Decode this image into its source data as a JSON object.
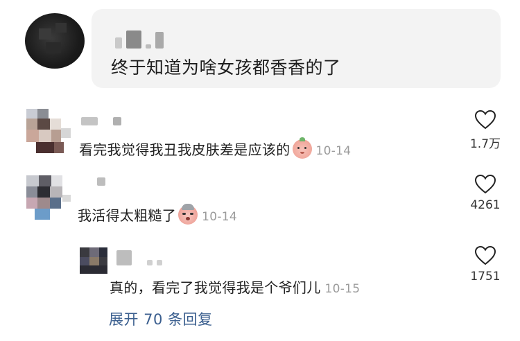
{
  "top_comment": {
    "text": "终于知道为啥女孩都香香的了"
  },
  "comments": [
    {
      "text": "看完我觉得我丑我皮肤差是应该的",
      "date": "10-14",
      "emoji": "peach-face-emoji",
      "likes": "1.7万"
    },
    {
      "text": "我活得太粗糙了",
      "date": "10-14",
      "emoji": "crying-face-emoji",
      "likes": "4261"
    }
  ],
  "reply": {
    "text": "真的，看完了我觉得我是个爷们儿",
    "date": "10-15",
    "likes": "1751"
  },
  "expand_label": "展开 70 条回复",
  "colors": {
    "accent": "#3b5f8f",
    "date": "#9b9b9b",
    "card": "#f3f3f3"
  }
}
